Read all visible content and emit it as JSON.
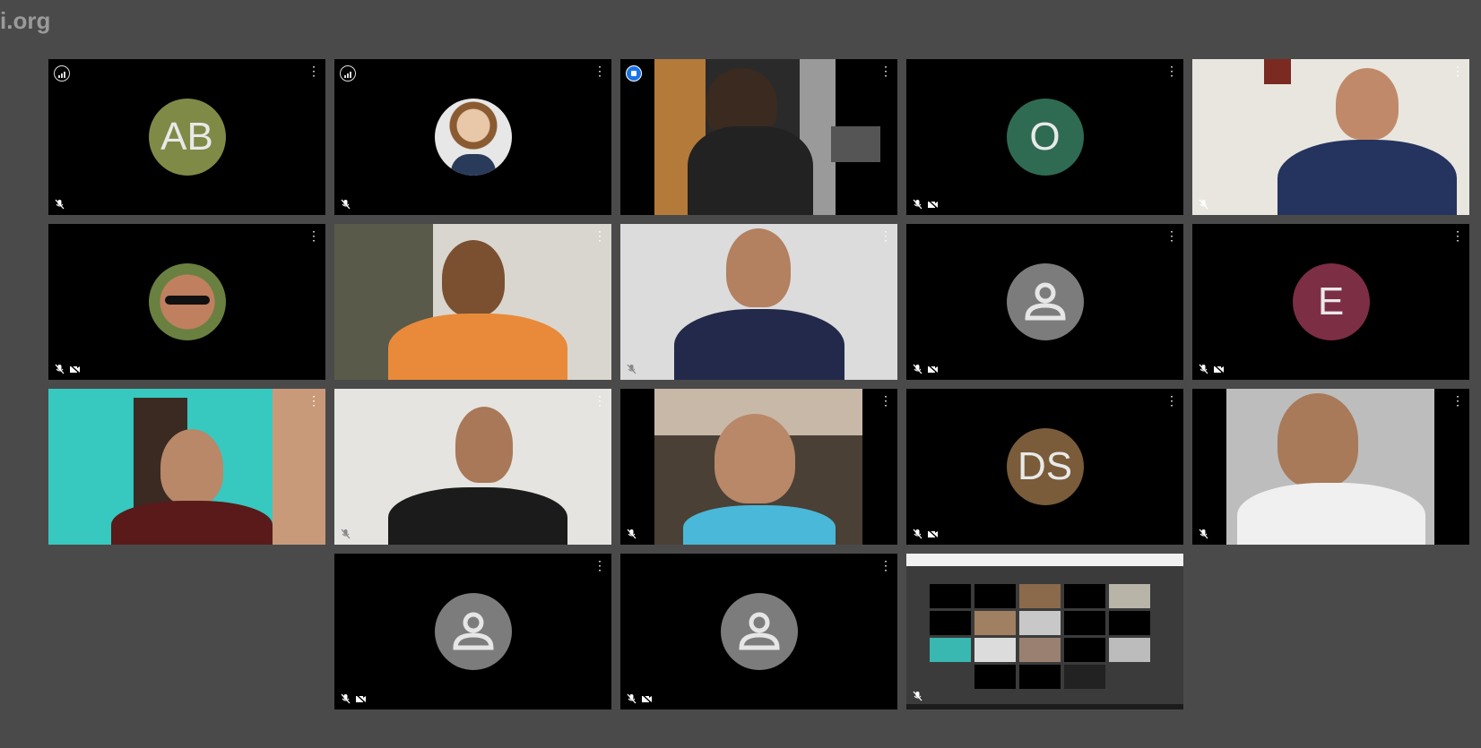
{
  "header": {
    "brand_text": "i.org"
  },
  "colors": {
    "background": "#4a4a4a",
    "tile": "#000000",
    "active_speaker": "#1a73e8",
    "avatar_ab": "#7f8a47",
    "avatar_o": "#2e6b52",
    "avatar_e": "#7c2e44",
    "avatar_ds": "#7a5c3a",
    "avatar_person": "#7c7c7c"
  },
  "tiles": [
    {
      "type": "initials",
      "initials": "AB",
      "signal_icon": "signal-bars-icon",
      "mic": "muted",
      "camera": "on"
    },
    {
      "type": "photo-avatar",
      "signal_icon": "signal-bars-icon",
      "mic": "muted",
      "camera": "on"
    },
    {
      "type": "video",
      "speaking": true,
      "signal_icon": "speaking-icon",
      "mic": "unmuted"
    },
    {
      "type": "initials",
      "initials": "O",
      "mic": "muted",
      "camera": "off"
    },
    {
      "type": "video",
      "mic": "muted"
    },
    {
      "type": "photo-avatar",
      "mic": "muted",
      "camera": "off"
    },
    {
      "type": "video",
      "mic": "unmuted"
    },
    {
      "type": "video",
      "mic": "muted"
    },
    {
      "type": "person-placeholder",
      "mic": "muted",
      "camera": "off"
    },
    {
      "type": "initials",
      "initials": "E",
      "mic": "muted",
      "camera": "off"
    },
    {
      "type": "video",
      "mic": "muted"
    },
    {
      "type": "video",
      "mic": "muted"
    },
    {
      "type": "video",
      "mic": "muted"
    },
    {
      "type": "initials",
      "initials": "DS",
      "mic": "muted",
      "camera": "off"
    },
    {
      "type": "video",
      "mic": "muted"
    },
    {
      "type": "person-placeholder",
      "mic": "muted",
      "camera": "off"
    },
    {
      "type": "person-placeholder",
      "mic": "muted",
      "camera": "off"
    },
    {
      "type": "screen-share",
      "mic": "muted"
    }
  ]
}
